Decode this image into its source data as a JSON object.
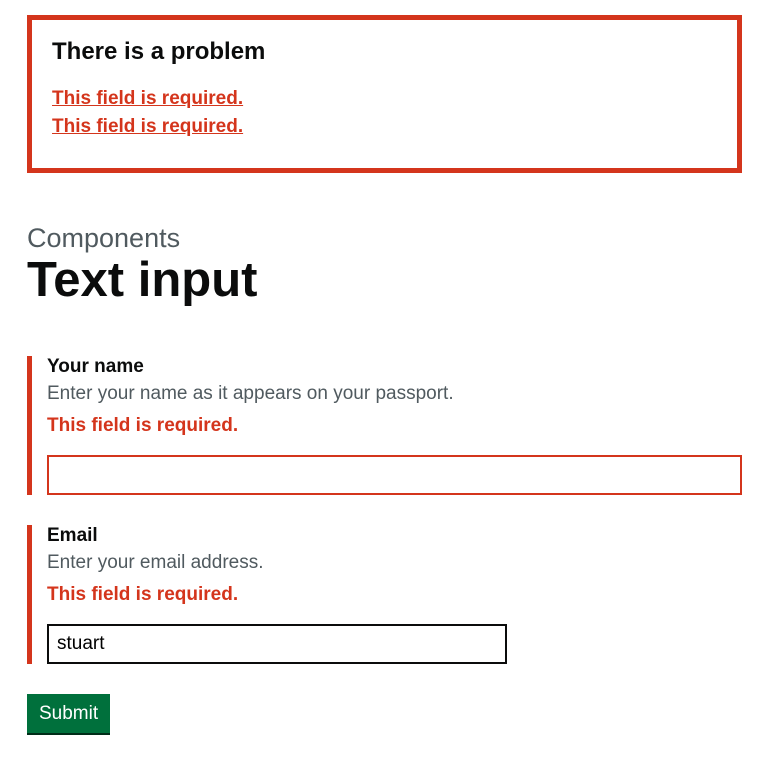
{
  "errorSummary": {
    "title": "There is a problem",
    "errors": [
      "This field is required.",
      "This field is required."
    ]
  },
  "heading": {
    "caption": "Components",
    "title": "Text input"
  },
  "fields": {
    "name": {
      "label": "Your name",
      "hint": "Enter your name as it appears on your passport.",
      "error": "This field is required.",
      "value": ""
    },
    "email": {
      "label": "Email",
      "hint": "Enter your email address.",
      "error": "This field is required.",
      "value": "stuart"
    }
  },
  "submit": {
    "label": "Submit"
  }
}
